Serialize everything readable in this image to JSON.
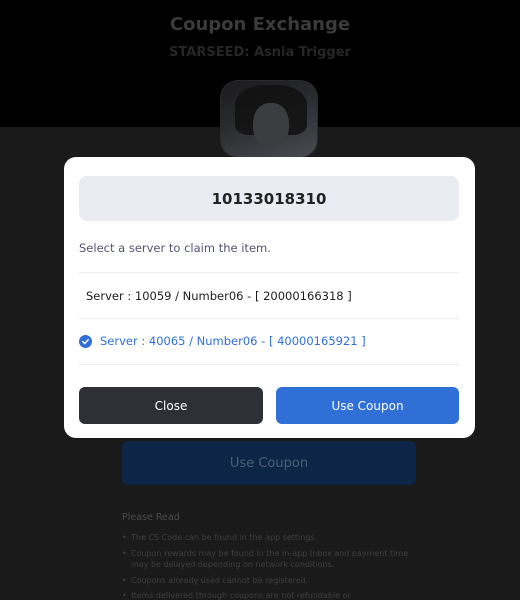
{
  "page": {
    "title": "Coupon Exchange",
    "subtitle": "STARSEED: Asnia Trigger",
    "use_coupon_label": "Use Coupon",
    "please_read": "Please Read",
    "notices": [
      "The CS Code can be found in the app settings.",
      "Coupon rewards may be found in the in-app Inbox and payment time may be delayed depending on network conditions.",
      "Coupons already used cannot be registered.",
      "Items delivered through coupons are not refundable or"
    ]
  },
  "modal": {
    "cs_code": "10133018310",
    "prompt": "Select a server to claim the item.",
    "servers": [
      {
        "label": "Server : 10059 / Number06 - [ 20000166318 ]",
        "selected": false
      },
      {
        "label": "Server : 40065 / Number06 - [ 40000165921 ]",
        "selected": true
      }
    ],
    "close_label": "Close",
    "use_coupon_label": "Use Coupon"
  },
  "colors": {
    "accent": "#2f6fd6",
    "overlay": "#1a1a1a",
    "close_button": "#2e3038"
  },
  "icons": {
    "selected": "check-circle-icon"
  }
}
